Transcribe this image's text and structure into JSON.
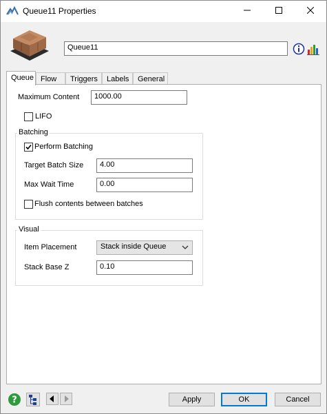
{
  "window": {
    "title": "Queue11  Properties",
    "icon": "flexsim-logo-icon",
    "controls": [
      "minimize-icon",
      "maximize-icon",
      "close-icon"
    ]
  },
  "header": {
    "object_name": "Queue11",
    "icons": [
      "queue-3d-icon",
      "info-icon",
      "stats-chart-icon"
    ]
  },
  "tabs": [
    {
      "label": "Queue",
      "active": true
    },
    {
      "label": "Flow"
    },
    {
      "label": "Triggers"
    },
    {
      "label": "Labels"
    },
    {
      "label": "General"
    }
  ],
  "queue": {
    "max_content_label": "Maximum Content",
    "max_content_value": "1000.00",
    "lifo_label": "LIFO",
    "lifo_checked": false,
    "batching": {
      "title": "Batching",
      "perform_label": "Perform Batching",
      "perform_checked": true,
      "target_label": "Target Batch Size",
      "target_value": "4.00",
      "wait_label": "Max Wait Time",
      "wait_value": "0.00",
      "flush_label": "Flush contents between batches",
      "flush_checked": false
    },
    "visual": {
      "title": "Visual",
      "placement_label": "Item Placement",
      "placement_value": "Stack inside Queue",
      "stack_label": "Stack Base Z",
      "stack_value": "0.10"
    }
  },
  "footer": {
    "apply": "Apply",
    "ok": "OK",
    "cancel": "Cancel",
    "icons": [
      "help-icon",
      "tree-icon",
      "prev-arrow-icon",
      "next-arrow-icon"
    ]
  },
  "colors": {
    "accent": "#0078d7",
    "panel": "#ffffff",
    "chrome": "#f0f0f0"
  }
}
